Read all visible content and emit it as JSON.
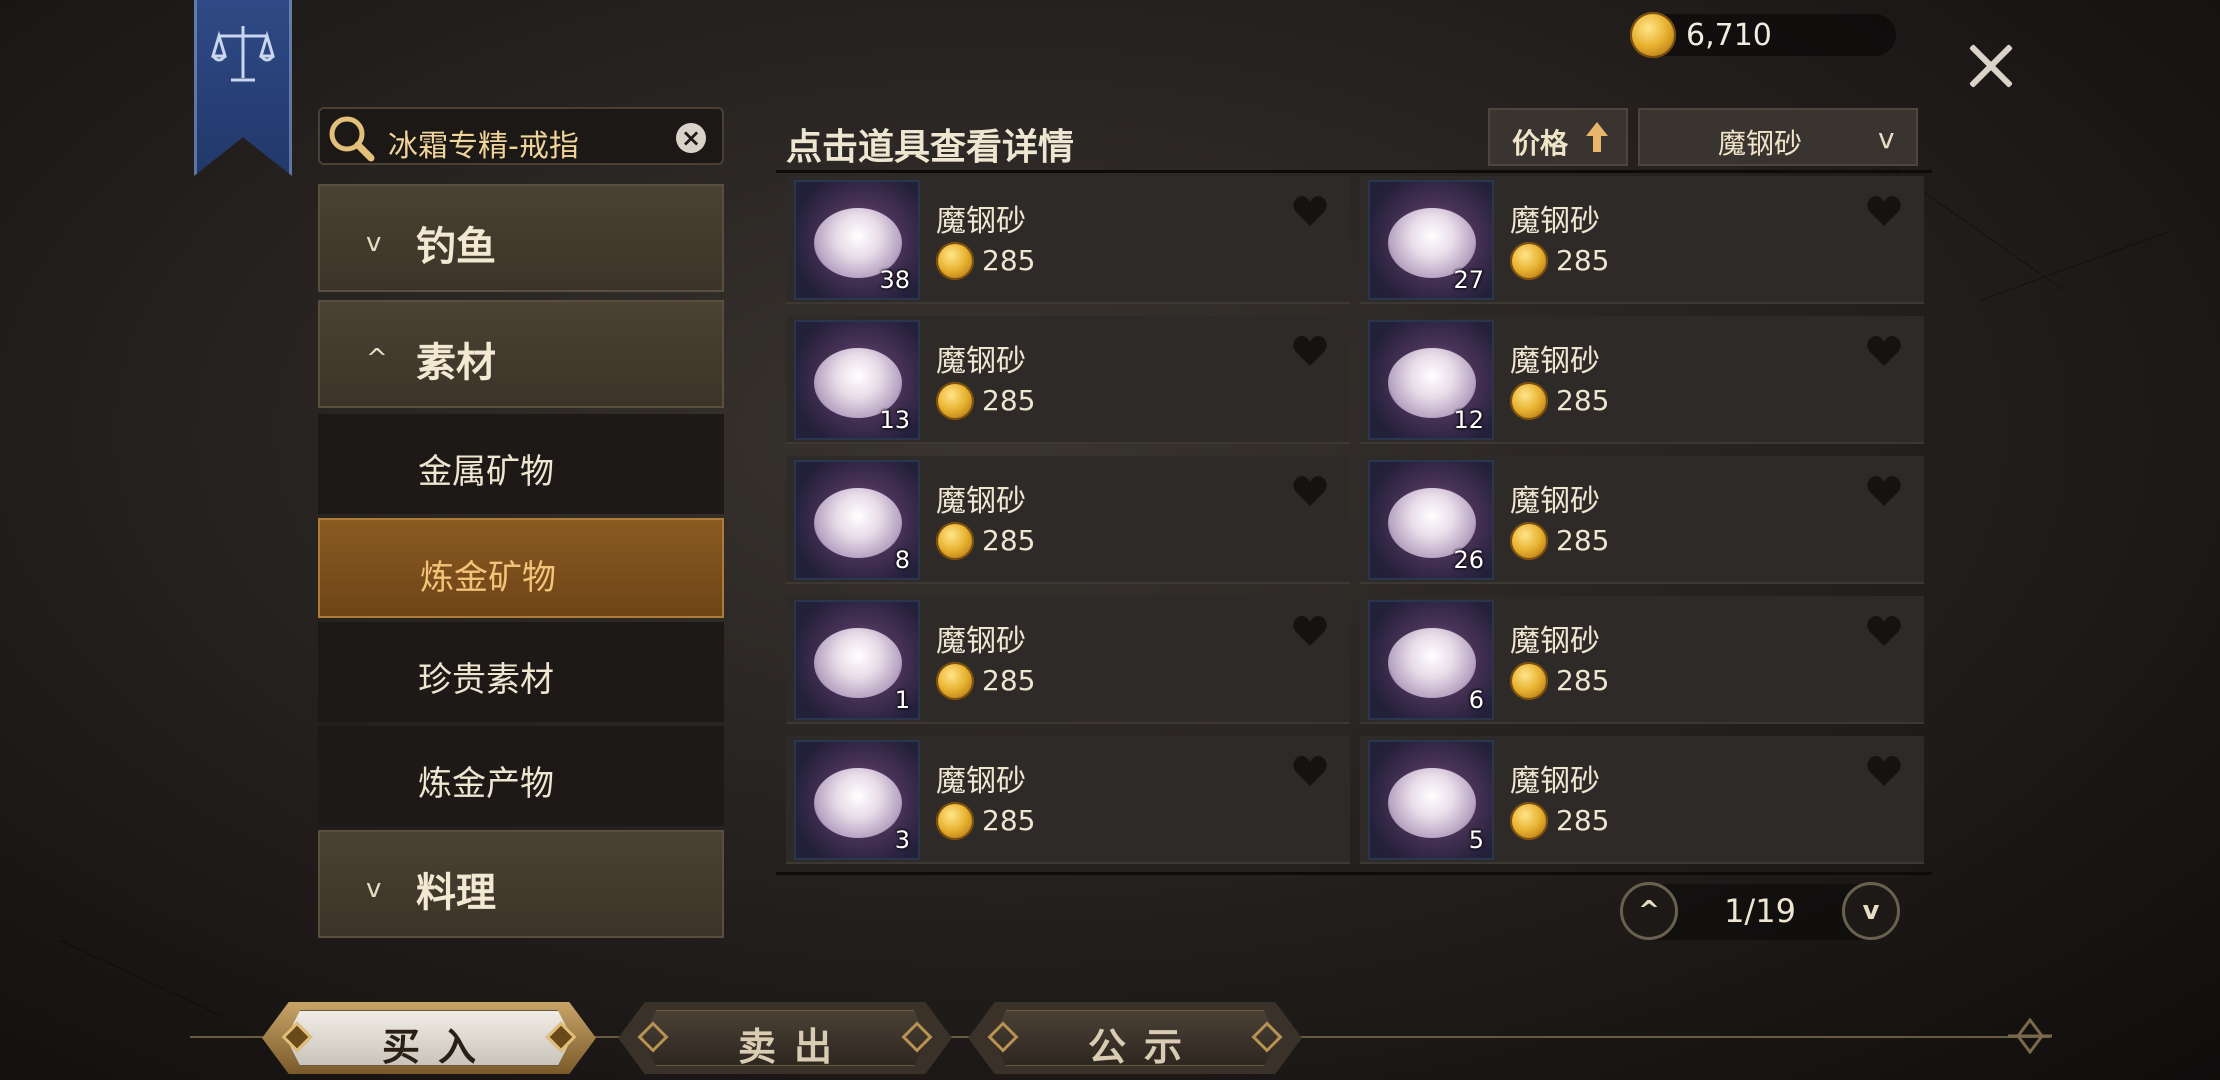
{
  "currency": {
    "gold": "6,710"
  },
  "search": {
    "query": "冰霜专精-戒指"
  },
  "sidebar": {
    "categories": [
      {
        "label": "钓鱼",
        "chevron": "v"
      },
      {
        "label": "素材",
        "chevron": "^"
      },
      {
        "label": "料理",
        "chevron": "v"
      }
    ],
    "subitems": [
      {
        "label": "金属矿物",
        "active": false
      },
      {
        "label": "炼金矿物",
        "active": true
      },
      {
        "label": "珍贵素材",
        "active": false
      },
      {
        "label": "炼金产物",
        "active": false
      }
    ]
  },
  "listing": {
    "hint": "点击道具查看详情",
    "sort_label": "价格",
    "filter_selected": "魔钢砂",
    "items": [
      {
        "name": "魔钢砂",
        "price": "285",
        "qty": "38"
      },
      {
        "name": "魔钢砂",
        "price": "285",
        "qty": "27"
      },
      {
        "name": "魔钢砂",
        "price": "285",
        "qty": "13"
      },
      {
        "name": "魔钢砂",
        "price": "285",
        "qty": "12"
      },
      {
        "name": "魔钢砂",
        "price": "285",
        "qty": "8"
      },
      {
        "name": "魔钢砂",
        "price": "285",
        "qty": "26"
      },
      {
        "name": "魔钢砂",
        "price": "285",
        "qty": "1"
      },
      {
        "name": "魔钢砂",
        "price": "285",
        "qty": "6"
      },
      {
        "name": "魔钢砂",
        "price": "285",
        "qty": "3"
      },
      {
        "name": "魔钢砂",
        "price": "285",
        "qty": "5"
      }
    ]
  },
  "pagination": {
    "page": "1/19"
  },
  "tabs": [
    {
      "label": "买入",
      "active": true
    },
    {
      "label": "卖出",
      "active": false
    },
    {
      "label": "公示",
      "active": false
    }
  ],
  "icons": {
    "banner": "scales-icon",
    "currency": "gold-coin-icon",
    "close": "close-icon",
    "search": "search-icon",
    "clear": "clear-icon",
    "favorite": "heart-icon",
    "sort": "arrow-up-icon"
  },
  "colors": {
    "accent": "#b07a3a",
    "banner": "#2f4a86",
    "gold": "#e8b230"
  }
}
